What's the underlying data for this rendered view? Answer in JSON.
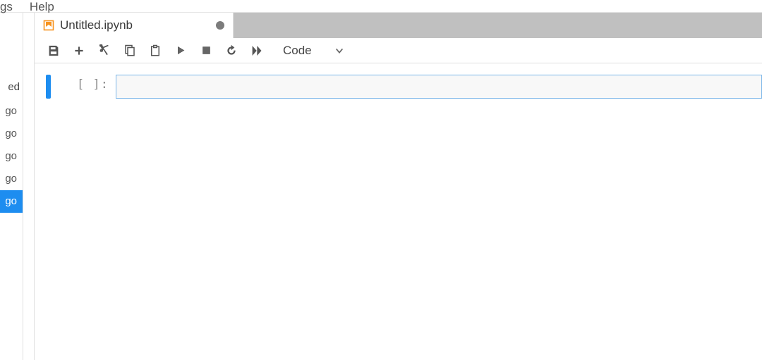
{
  "menu": {
    "settings": "tings",
    "help": "Help"
  },
  "sidebar": {
    "header": "ed",
    "items": [
      {
        "label": "go",
        "selected": false
      },
      {
        "label": "go",
        "selected": false
      },
      {
        "label": "go",
        "selected": false
      },
      {
        "label": "go",
        "selected": false
      },
      {
        "label": "go",
        "selected": true
      }
    ]
  },
  "tab": {
    "title": "Untitled.ipynb",
    "dirty": true
  },
  "toolbar": {
    "celltype_label": "Code"
  },
  "cell": {
    "prompt": "[ ]:",
    "value": ""
  }
}
